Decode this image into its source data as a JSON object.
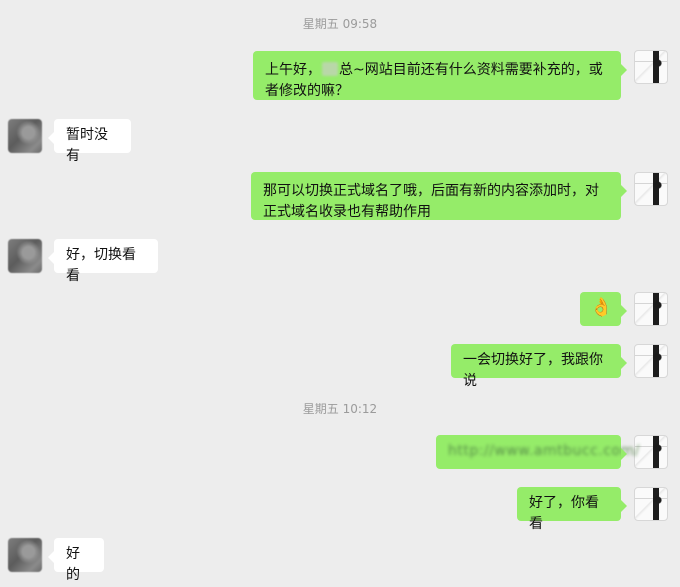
{
  "timestamps": [
    "星期五 09:58",
    "星期五 10:12"
  ],
  "messages": [
    {
      "from": "me",
      "parts": {
        "a": "上午好，",
        "b": "总~网站目前还有什么资料需要补充的，或者修改的嘛？"
      }
    },
    {
      "from": "them",
      "text": "暂时没有"
    },
    {
      "from": "me",
      "text": "那可以切换正式域名了哦，后面有新的内容添加时，对正式域名收录也有帮助作用"
    },
    {
      "from": "them",
      "text": "好，切换看看"
    },
    {
      "from": "me",
      "emoji": "👌"
    },
    {
      "from": "me",
      "text": "一会切换好了，我跟你说"
    },
    {
      "from": "me",
      "text": "http://www.amtbucc.com/"
    },
    {
      "from": "me",
      "text": "好了，你看看"
    },
    {
      "from": "them",
      "text": "好的"
    }
  ],
  "icons": {
    "my_avatar": "user-avatar-icon",
    "their_avatar": "contact-avatar-icon"
  },
  "colors": {
    "background": "#ededed",
    "my_bubble": "#95ec69",
    "their_bubble": "#ffffff",
    "timestamp": "#9b9b9b"
  }
}
